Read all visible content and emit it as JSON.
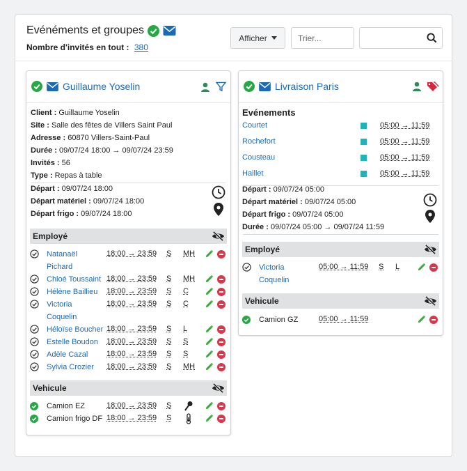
{
  "header": {
    "title": "Evénéments et groupes",
    "subtitle_label": "Nombre d'invités en tout :",
    "guest_count": "380",
    "afficher_label": "Afficher",
    "sort_placeholder": "Trier...",
    "search_value": ""
  },
  "colors": {
    "accent": "#1a6ab8",
    "success": "#28a745",
    "danger": "#d9364a",
    "teal": "#1fb5b8"
  },
  "card1": {
    "title": "Guillaume Yoselin",
    "info": [
      {
        "label": "Client :",
        "value": "Guillaume Yoselin"
      },
      {
        "label": "Site :",
        "value": "Salle des fêtes de Villers Saint Paul"
      },
      {
        "label": "Adresse :",
        "value": "60870 Villers-Saint-Paul"
      },
      {
        "label": "Durée :",
        "value": "09/07/24 18:00 → 09/07/24 23:59"
      },
      {
        "label": "Invités :",
        "value": "56"
      },
      {
        "label": "Type :",
        "value": "Repas à table"
      }
    ],
    "times": [
      {
        "label": "Départ :",
        "value": "09/07/24 18:00"
      },
      {
        "label": "Départ matériel :",
        "value": "09/07/24 18:00"
      },
      {
        "label": "Départ frigo :",
        "value": "09/07/24 18:00"
      }
    ],
    "employe_title": "Employé",
    "employees": [
      {
        "name1": "Natanaël",
        "name2": "Pichard",
        "time": "18:00 → 23:59",
        "s": "S",
        "role": "MH"
      },
      {
        "name1": "Chloé Toussaint",
        "name2": "",
        "time": "18:00 → 23:59",
        "s": "S",
        "role": "MH"
      },
      {
        "name1": "Hélène Baillieu",
        "name2": "",
        "time": "18:00 → 23:59",
        "s": "S",
        "role": "C"
      },
      {
        "name1": "Victoria",
        "name2": "Coquelin",
        "time": "18:00 → 23:59",
        "s": "S",
        "role": "C"
      },
      {
        "name1": "Héloïse Boucher",
        "name2": "",
        "time": "18:00 → 23:59",
        "s": "S",
        "role": "L"
      },
      {
        "name1": "Estelle Boudon",
        "name2": "",
        "time": "18:00 → 23:59",
        "s": "S",
        "role": "S"
      },
      {
        "name1": "Adèle Cazal",
        "name2": "",
        "time": "18:00 → 23:59",
        "s": "S",
        "role": "S"
      },
      {
        "name1": "Sylvia Crozier",
        "name2": "",
        "time": "18:00 → 23:59",
        "s": "S",
        "role": "MH"
      }
    ],
    "vehicule_title": "Vehicule",
    "vehicles": [
      {
        "name": "Camion EZ",
        "time": "18:00 → 23:59",
        "s": "S",
        "icon": "microphone-icon"
      },
      {
        "name": "Camion frigo DF",
        "time": "18:00 → 23:59",
        "s": "S",
        "icon": "thermometer-icon"
      }
    ]
  },
  "card2": {
    "title": "Livraison Paris",
    "events_title": "Evénements",
    "events": [
      {
        "name": "Courtet",
        "time": "05:00 → 11:59"
      },
      {
        "name": "Rochefort",
        "time": "05:00 → 11:59"
      },
      {
        "name": "Cousteau",
        "time": "05:00 → 11:59"
      },
      {
        "name": "Haillet",
        "time": "05:00 → 11:59"
      }
    ],
    "times": [
      {
        "label": "Départ :",
        "value": "09/07/24 05:00"
      },
      {
        "label": "Départ matériel :",
        "value": "09/07/24 05:00"
      },
      {
        "label": "Départ frigo :",
        "value": "09/07/24 05:00"
      },
      {
        "label": "Durée :",
        "value": "09/07/24 05:00 → 09/07/24 11:59"
      }
    ],
    "employe_title": "Employé",
    "employees": [
      {
        "name1": "Victoria",
        "name2": "Coquelin",
        "time": "05:00 → 11:59",
        "s": "S",
        "role": "L"
      }
    ],
    "vehicule_title": "Vehicule",
    "vehicles": [
      {
        "name": "Camion GZ",
        "time": "05:00 → 11:59"
      }
    ]
  }
}
